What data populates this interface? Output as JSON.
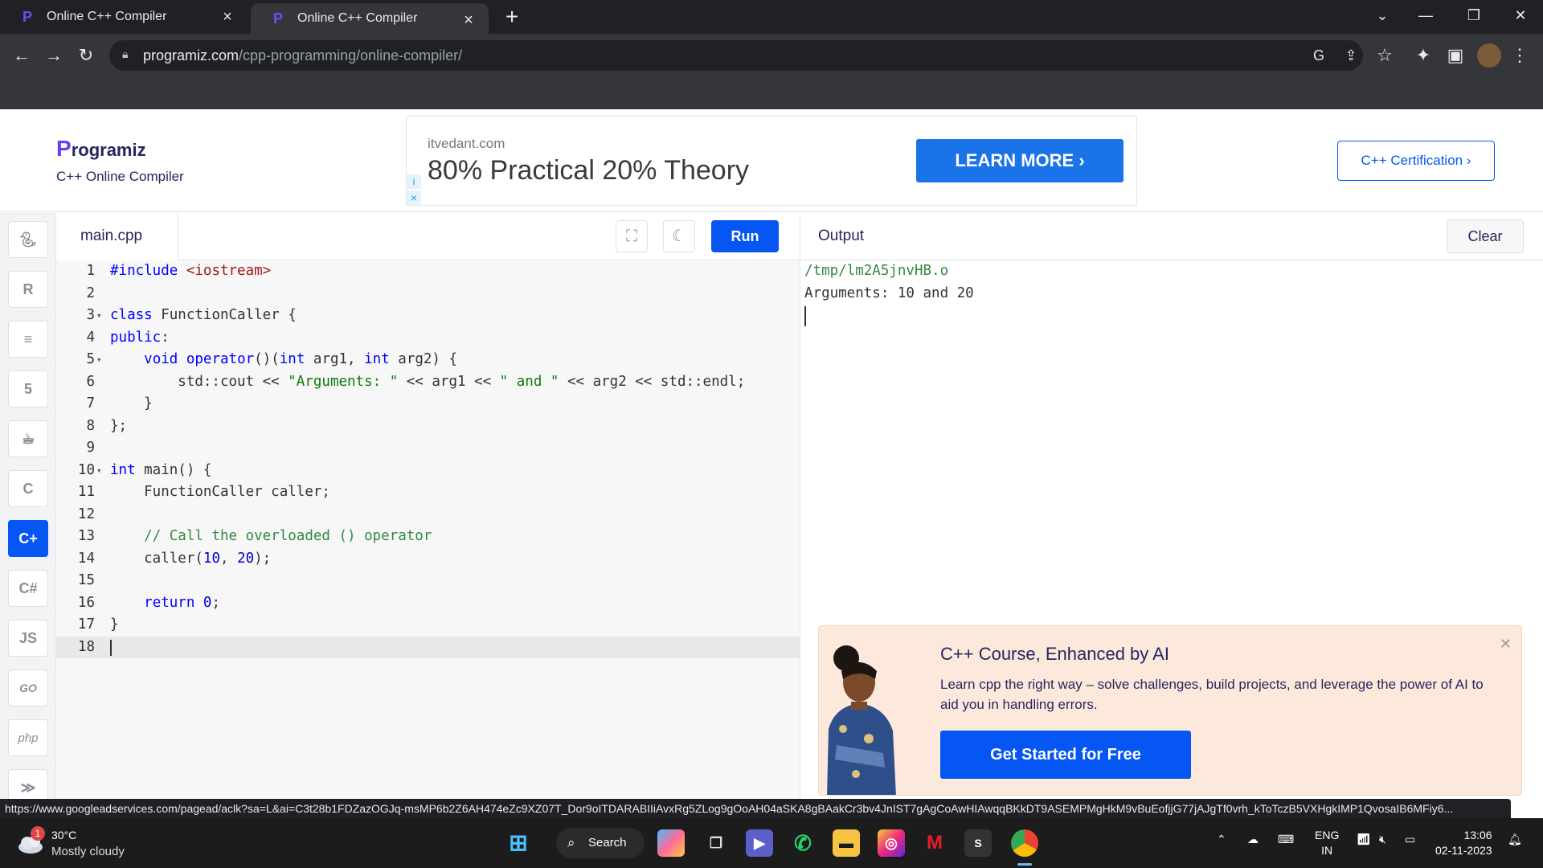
{
  "browser": {
    "tabs": [
      {
        "title": "Online C++ Compiler"
      },
      {
        "title": "Online C++ Compiler"
      }
    ],
    "url_host": "programiz.com",
    "url_path": "/cpp-programming/online-compiler/",
    "status_link": "https://www.googleadservices.com/pagead/aclk?sa=L&ai=C3t28b1FDZazOGJq-msMP6b2Z6AH474eZc9XZ07T_Dor9oITDARABIIiAvxRg5ZLog9gOoAH04aSKA8gBAakCr3bv4JnIST7gAgCoAwHIAwqqBKkDT9ASEMPMgHkM9vBuEofjjG77jAJgTf0vrh_kToTczB5VXHgkIMP1QvosaIB6MFiy6..."
  },
  "site": {
    "logo_text": "rogramiz",
    "logo_letter": "P",
    "subtitle": "C++ Online Compiler",
    "cert_button": "C++ Certification ›"
  },
  "ad": {
    "domain": "itvedant.com",
    "headline": "80% Practical 20% Theory",
    "button": "LEARN MORE"
  },
  "rail": {
    "languages": [
      "python",
      "r",
      "sql",
      "html",
      "java",
      "c",
      "cpp",
      "csharp",
      "js",
      "go",
      "php",
      "swift"
    ],
    "labels": {
      "js": "JS",
      "go": "GO",
      "php": "php"
    }
  },
  "editor": {
    "filename": "main.cpp",
    "run_label": "Run",
    "code_lines": [
      "#include <iostream>",
      "",
      "class FunctionCaller {",
      "public:",
      "    void operator()(int arg1, int arg2) {",
      "        std::cout << \"Arguments: \" << arg1 << \" and \" << arg2 << std::endl;",
      "    }",
      "};",
      "",
      "int main() {",
      "    FunctionCaller caller;",
      "",
      "    // Call the overloaded () operator",
      "    caller(10, 20);",
      "",
      "    return 0;",
      "}",
      ""
    ]
  },
  "output": {
    "title": "Output",
    "clear_label": "Clear",
    "lines": [
      "/tmp/lm2A5jnvHB.o",
      "Arguments: 10 and 20"
    ]
  },
  "promo": {
    "title": "C++ Course, Enhanced by AI",
    "text": "Learn cpp the right way – solve challenges, build projects, and leverage the power of AI to aid you in handling errors.",
    "button": "Get Started for Free"
  },
  "taskbar": {
    "weather_badge": "1",
    "temperature": "30°C",
    "condition": "Mostly cloudy",
    "search_label": "Search",
    "lang_line1": "ENG",
    "lang_line2": "IN",
    "time": "13:06",
    "date": "02-11-2023"
  },
  "colors": {
    "accent": "#0556f3",
    "brand_purple": "#6a3df5",
    "chrome_dark": "#202124",
    "promo_bg": "#fde9dc"
  }
}
